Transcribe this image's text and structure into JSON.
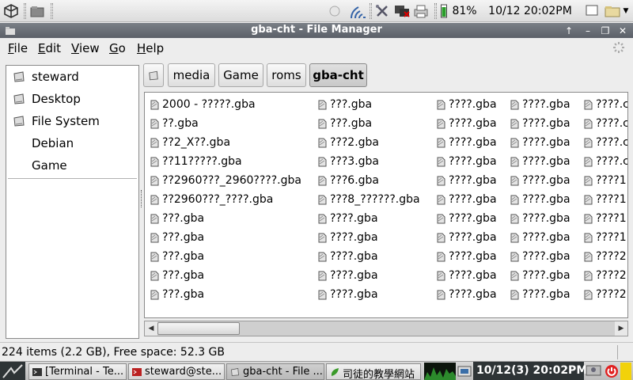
{
  "top_panel": {
    "battery": "81%",
    "clock": "10/12 20:02PM"
  },
  "window": {
    "title": "gba-cht - File Manager",
    "buttons": [
      "↑",
      "–",
      "❐",
      "✕"
    ]
  },
  "menu": [
    {
      "label": "File"
    },
    {
      "label": "Edit"
    },
    {
      "label": "View"
    },
    {
      "label": "Go"
    },
    {
      "label": "Help"
    }
  ],
  "places": [
    {
      "label": "steward",
      "icon": "drive-icon"
    },
    {
      "label": "Desktop",
      "icon": "drive-icon"
    },
    {
      "label": "File System",
      "icon": "drive-icon"
    },
    {
      "label": "Debian",
      "icon": ""
    },
    {
      "label": "Game",
      "icon": ""
    }
  ],
  "path": {
    "segments": [
      "media",
      "Game",
      "roms",
      "gba-cht"
    ],
    "active": "gba-cht"
  },
  "files": {
    "columns": [
      [
        "2000 - ?????.gba",
        "??.gba",
        "??2_X??.gba",
        "??11?????.gba",
        "??2960???_2960????.gba",
        "??2960???_????.gba",
        "???.gba",
        "???.gba",
        "???.gba",
        "???.gba",
        "???.gba"
      ],
      [
        "???.gba",
        "???.gba",
        "???2.gba",
        "???3.gba",
        "???6.gba",
        "???8_??????.gba",
        "????.gba",
        "????.gba",
        "????.gba",
        "????.gba",
        "????.gba"
      ],
      [
        "????.gba",
        "????.gba",
        "????.gba",
        "????.gba",
        "????.gba",
        "????.gba",
        "????.gba",
        "????.gba",
        "????.gba",
        "????.gba",
        "????.gba"
      ],
      [
        "????.gba",
        "????.gba",
        "????.gba",
        "????.gba",
        "????.gba",
        "????.gba",
        "????.gba",
        "????.gba",
        "????.gba",
        "????.gba",
        "????.gba"
      ],
      [
        "????.c",
        "????.c",
        "????.c",
        "????.c",
        "????1",
        "????1",
        "????1",
        "????1",
        "????2",
        "????2",
        "????2"
      ]
    ]
  },
  "status": {
    "text": "224 items (2.2 GB), Free space: 52.3 GB"
  },
  "taskbar": {
    "tasks": [
      {
        "label": "[Terminal - Te...",
        "active": false
      },
      {
        "label": "steward@ste...",
        "active": false
      },
      {
        "label": "gba-cht - File ...",
        "active": true
      },
      {
        "label": "司徒的教學網站",
        "active": false
      }
    ],
    "clock": "10/12(3) 20:02PM"
  },
  "colors": {
    "title_bar": "#5b6068",
    "battery": "#2a9d2a",
    "power": "#e02020",
    "trash": "#f2d20a"
  }
}
